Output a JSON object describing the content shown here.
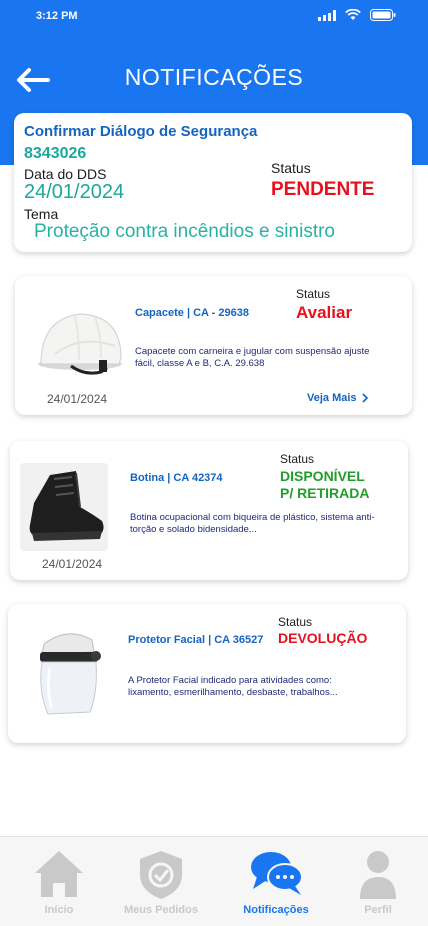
{
  "status_bar": {
    "time": "3:12 PM"
  },
  "header": {
    "title": "NOTIFICAÇÕES"
  },
  "dds": {
    "title": "Confirmar Diálogo de Segurança",
    "number": "8343026",
    "date_label": "Data do DDS",
    "date": "24/01/2024",
    "tema_label": "Tema",
    "tema": "Proteção contra incêndios e sinistro",
    "status_label": "Status",
    "status": "PENDENTE"
  },
  "products": [
    {
      "name": "Capacete | CA - 29638",
      "description": "Capacete com carneira e jugular com  suspensão ajuste fácil, classe A e B, C.A. 29.638",
      "status_label": "Status",
      "status": "Avaliar",
      "date": "24/01/2024",
      "link": "Veja Mais",
      "icon": "helmet-image"
    },
    {
      "name": "Botina | CA 42374",
      "description": "Botina ocupacional com biqueira de plástico, sistema anti-torção e solado bidensidade...",
      "status_label": "Status",
      "status_line1": "DISPONÍVEL",
      "status_line2": "P/ RETIRADA",
      "date": "24/01/2024",
      "icon": "boot-image"
    },
    {
      "name": "Protetor Facial | CA 36527",
      "description": "A Protetor Facial indicado para atividades como: lixamento, esmerilhamento, desbaste, trabalhos...",
      "status_label": "Status",
      "status": "DEVOLUÇÃO",
      "icon": "face-shield-image"
    }
  ],
  "tabs": [
    {
      "label": "Início",
      "icon": "home-icon",
      "active": false
    },
    {
      "label": "Meus Pedidos",
      "icon": "shield-check-icon",
      "active": false
    },
    {
      "label": "Notificações",
      "icon": "chat-bubbles-icon",
      "active": true
    },
    {
      "label": "Perfil",
      "icon": "person-icon",
      "active": false
    }
  ],
  "colors": {
    "brand": "#1976f0",
    "teal": "#1aa89b",
    "red": "#e8101c",
    "green": "#1f9e2a",
    "tab_inactive": "#c9c9c9"
  }
}
